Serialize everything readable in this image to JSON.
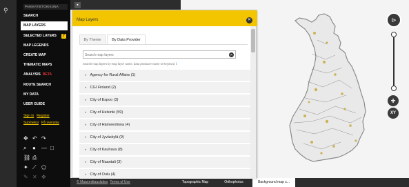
{
  "sidebar": {
    "brand": "PAIKKATIETOIKKUNA",
    "menu": [
      {
        "label": "SEARCH"
      },
      {
        "label": "MAP LAYERS"
      },
      {
        "label": "SELECTED LAYERS",
        "badge": "7"
      },
      {
        "label": "MAP LEGENDS"
      },
      {
        "label": "CREATE MAP"
      },
      {
        "label": "THEMATIC MAPS"
      },
      {
        "label": "ANALYSIS",
        "beta": "BETA"
      },
      {
        "label": "ROUTE SEARCH"
      },
      {
        "label": "MY DATA"
      },
      {
        "label": "USER GUIDE"
      }
    ],
    "account": {
      "login": "Sign in",
      "register": "Register"
    },
    "languages": {
      "fi": "Suomeksi",
      "sv": "På svenska"
    }
  },
  "panel": {
    "title": "Map Layers",
    "tabs": [
      "By Theme",
      "By Data Provider"
    ],
    "search_placeholder": "Search map layers",
    "search_hint": "Search map layers by map layer name, data producer name or keyword",
    "providers": [
      "Agency for Rural Affairs (1)",
      "CGI Finland (2)",
      "City of Espoo (3)",
      "City of Helsinki (59)",
      "City of Hämeenlinna (4)",
      "City of Jyväskylä (9)",
      "City of Kauhava (8)",
      "City of Naantali (3)",
      "City of Oulu (4)"
    ]
  },
  "map": {
    "background_tabs": [
      "Topographic Map",
      "Orthophotos",
      "Background map s..."
    ],
    "attribution": [
      "© Maanmittauslaitos",
      "Terms of Use"
    ]
  },
  "colors": {
    "accent": "#f2c500",
    "sidebar": "#0d0d0d"
  }
}
